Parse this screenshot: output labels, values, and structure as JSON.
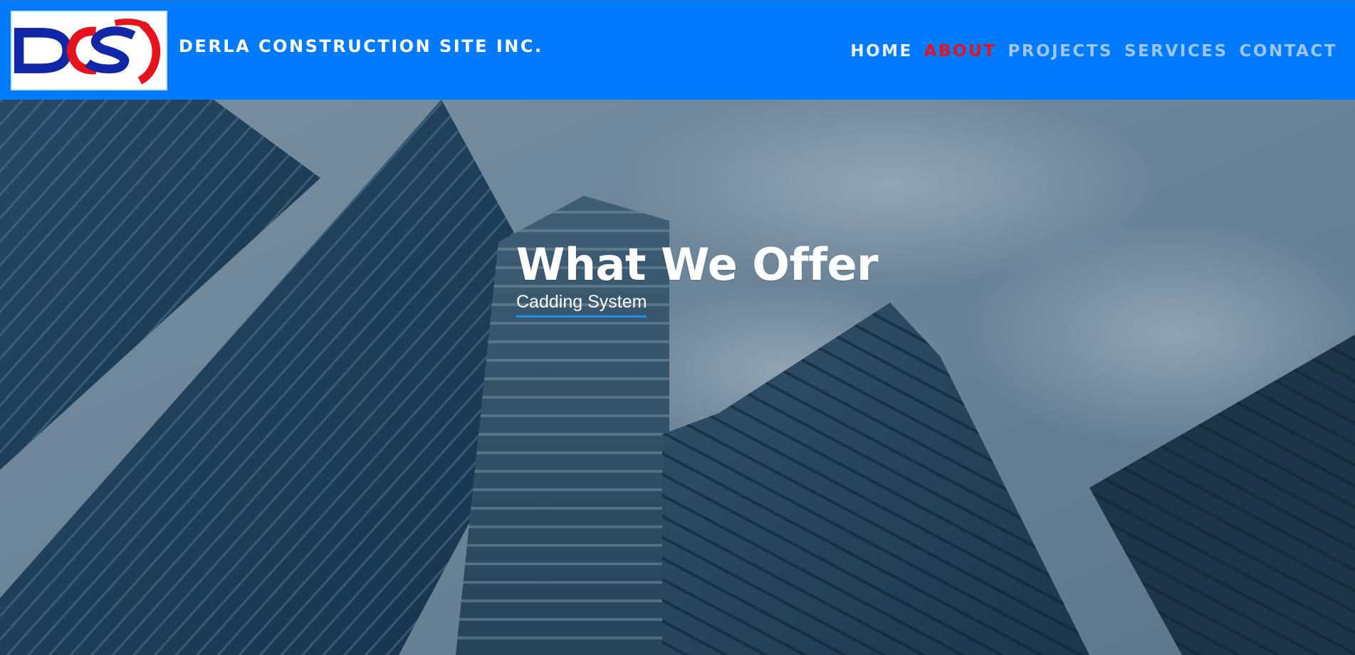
{
  "header": {
    "logo": {
      "text": "DCSI",
      "colors": {
        "blue": "#1226a8",
        "red": "#e8121c"
      }
    },
    "brand_name": "DERLA CONSTRUCTION SITE INC.",
    "background": "#007bff"
  },
  "nav": {
    "items": [
      {
        "label": "HOME",
        "state": "normal"
      },
      {
        "label": "ABOUT",
        "state": "active"
      },
      {
        "label": "PROJECTS",
        "state": "dim"
      },
      {
        "label": "SERVICES",
        "state": "dim"
      },
      {
        "label": "CONTACT",
        "state": "dim"
      }
    ],
    "active_color": "#e8121c"
  },
  "hero": {
    "title": "What We Offer",
    "subtitle": "Cadding System",
    "underline_color": "#1e90e6"
  }
}
